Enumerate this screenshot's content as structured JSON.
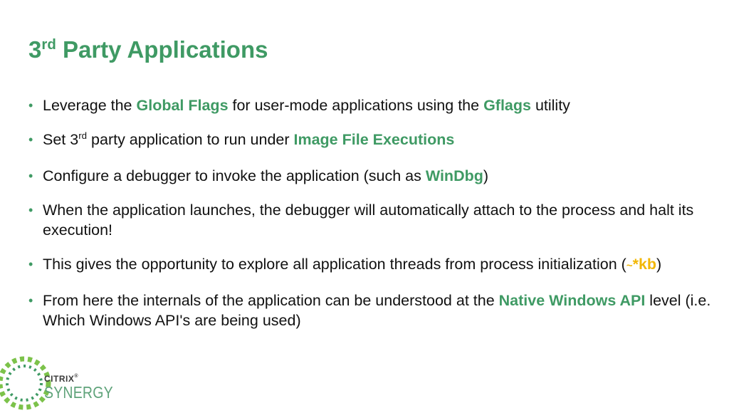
{
  "title": {
    "prefix": "3",
    "sup": "rd",
    "rest": " Party Applications"
  },
  "bullets": [
    {
      "t1": "Leverage the ",
      "h1": "Global Flags",
      "t2": " for user-mode applications using the ",
      "h2": "Gflags",
      "t3": " utility"
    },
    {
      "t1": "Set 3",
      "sup": "rd",
      "t2": " party application to run under ",
      "h1": "Image File Executions"
    },
    {
      "t1": "Configure a debugger to invoke the application (such as ",
      "h1": "WinDbg",
      "t2": ")"
    },
    {
      "t1": "When the application launches, the debugger will automatically attach to the process and halt its execution!"
    },
    {
      "t1": "This gives the opportunity to explore all application threads from process initialization (",
      "tilde": "~",
      "h1": "*kb",
      "t2": ")"
    },
    {
      "t1": "From here the internals of the application can be understood at the ",
      "h1": "Native Windows API",
      "t2": " level (i.e. Which Windows API's are being used)"
    }
  ],
  "logo": {
    "brand": "CITRIX",
    "trademark": "®",
    "product": "SYNERGY"
  },
  "colors": {
    "accent_green": "#3f9a64",
    "highlight_yellow": "#f2b705",
    "text": "#111111"
  }
}
